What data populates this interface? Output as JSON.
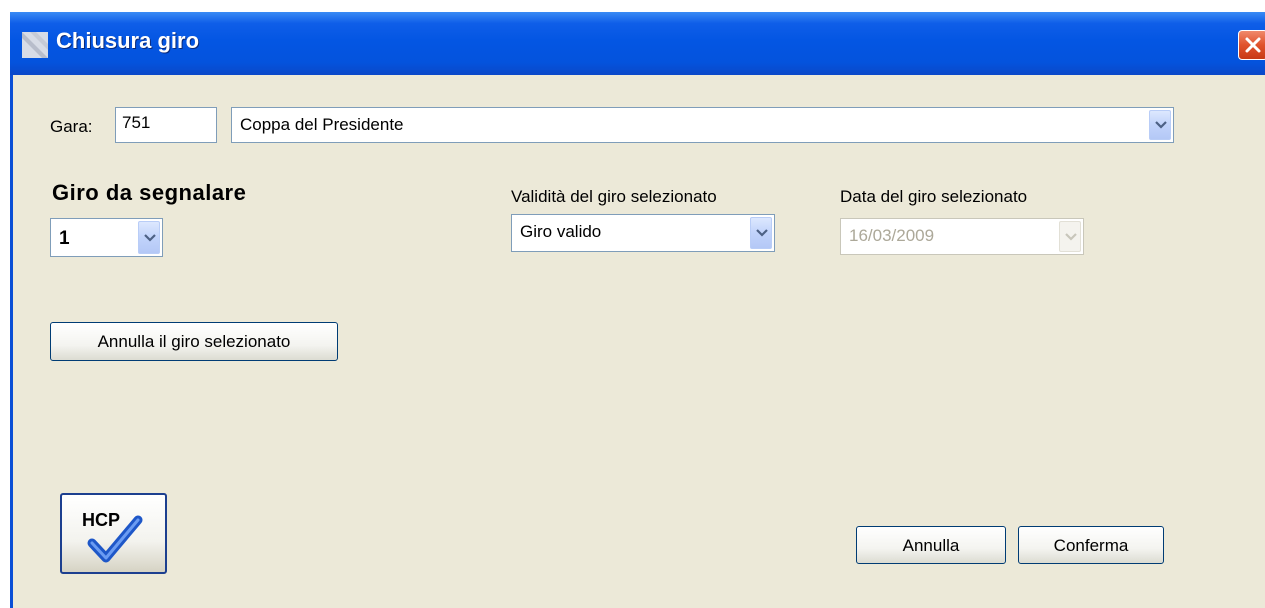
{
  "window": {
    "title": "Chiusura giro"
  },
  "gara": {
    "label": "Gara:",
    "code": "751",
    "name": "Coppa del Presidente"
  },
  "giro": {
    "section_title": "Giro da segnalare",
    "selected": "1"
  },
  "validita": {
    "label": "Validità del giro selezionato",
    "selected": "Giro valido"
  },
  "data_giro": {
    "label": "Data del giro selezionato",
    "value": "16/03/2009"
  },
  "buttons": {
    "annulla_giro": "Annulla il giro selezionato",
    "annulla": "Annulla",
    "conferma": "Conferma"
  },
  "hcp_button": {
    "text": "HCP",
    "icon": "hcp-checkmark-icon"
  },
  "colors": {
    "titlebar": "#0456e3",
    "dialog_bg": "#ece9d8",
    "close_button": "#e0522c",
    "checkmark": "#2a6ae0"
  }
}
